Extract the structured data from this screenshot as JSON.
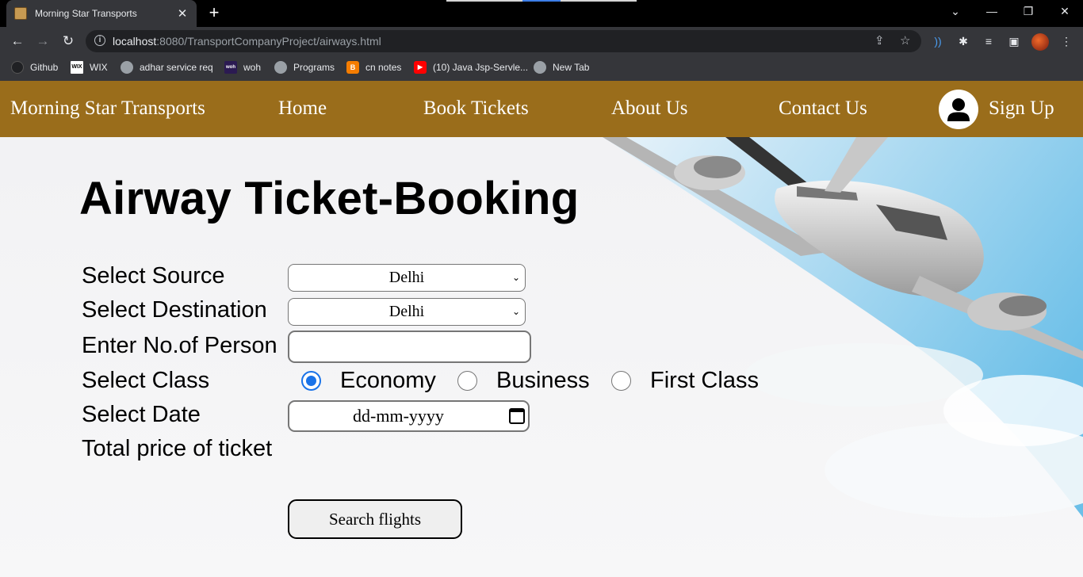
{
  "browser": {
    "tab_title": "Morning Star Transports",
    "tab_close": "✕",
    "new_tab": "+",
    "url_host": "localhost",
    "url_rest": ":8080/TransportCompanyProject/airways.html",
    "window_controls": {
      "minimize": "—",
      "restore": "❐",
      "close": "✕",
      "tabs_dropdown": "⌄"
    },
    "nav": {
      "back": "←",
      "forward": "→",
      "reload": "↻"
    },
    "bookmarks": [
      {
        "label": "Github",
        "icon": "github-icon"
      },
      {
        "label": "WIX",
        "icon": "wix-icon"
      },
      {
        "label": "adhar service req",
        "icon": "globe-icon"
      },
      {
        "label": "woh",
        "icon": "woh-icon"
      },
      {
        "label": "Programs",
        "icon": "globe-icon"
      },
      {
        "label": "cn notes",
        "icon": "blogger-icon"
      },
      {
        "label": "(10) Java Jsp-Servle...",
        "icon": "youtube-icon"
      },
      {
        "label": "New Tab",
        "icon": "globe-icon"
      }
    ],
    "colors": {
      "tabstrip": "#000000",
      "toolbar": "#35363a",
      "omnibox": "#202124"
    }
  },
  "site_nav": {
    "brand": "Morning Star Transports",
    "links": [
      "Home",
      "Book Tickets",
      "About Us",
      "Contact Us"
    ],
    "signup": "Sign Up",
    "color": "#9a6d1b"
  },
  "form": {
    "title": "Airway Ticket-Booking",
    "source_label": "Select Source",
    "source_value": "Delhi",
    "destination_label": "Select Destination",
    "destination_value": "Delhi",
    "persons_label": "Enter No.of Person",
    "persons_value": "",
    "class_label": "Select Class",
    "class_options": [
      "Economy",
      "Business",
      "First Class"
    ],
    "class_selected": "Economy",
    "date_label": "Select Date",
    "date_placeholder": "dd-mm-yyyy",
    "total_label": "Total price of ticket",
    "search_button": "Search flights",
    "radio_color": "#1a73e8"
  }
}
